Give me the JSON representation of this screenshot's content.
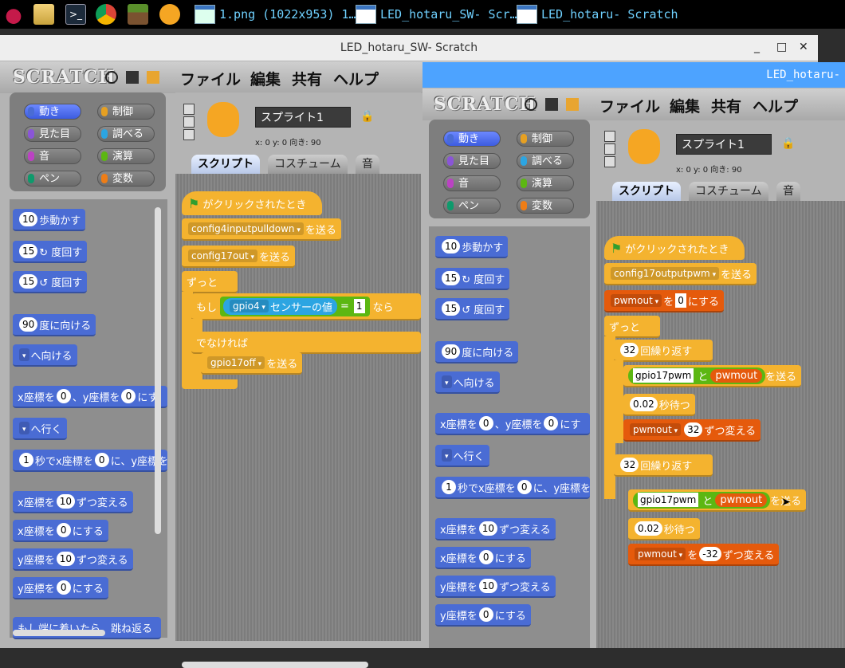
{
  "taskbar": {
    "tasks": [
      {
        "label": "1.png (1022x953) 1…"
      },
      {
        "label": "LED_hotaru_SW- Scr…"
      },
      {
        "label": "LED_hotaru- Scratch"
      }
    ]
  },
  "win1": {
    "title": "LED_hotaru_SW- Scratch",
    "logo": "SCRATCH",
    "menu": [
      "ファイル",
      "編集",
      "共有",
      "ヘルプ"
    ],
    "categories": [
      "動き",
      "制御",
      "見た目",
      "調べる",
      "音",
      "演算",
      "ペン",
      "変数"
    ],
    "sprite_name": "スプライト1",
    "coords": "x: 0   y: 0   向き: 90",
    "tabs": [
      "スクリプト",
      "コスチューム",
      "音"
    ],
    "palette": {
      "move": "歩動かす",
      "move_n": "10",
      "turn_r": "↻ 度回す",
      "turn_l": "↺ 度回す",
      "turn_n": "15",
      "point_dir": "度に向ける",
      "point_n": "90",
      "point_to": "へ向ける",
      "goto_xy_a": "x座標を",
      "goto_xy_b": "、y座標を",
      "goto_xy_c": "にす",
      "goto": "へ行く",
      "glide_a": "秒でx座標を",
      "glide_b": "に、y座標を",
      "change_x": "x座標を",
      "change_by": "ずつ変える",
      "set_x": "x座標を",
      "set_to": "にする",
      "change_y": "y座標を",
      "set_y": "y座標を",
      "bounce": "もし端に着いたら、跳ね返る",
      "zero": "0",
      "one": "1",
      "ten": "10"
    },
    "script": {
      "hat": "がクリックされたとき",
      "b1": "config4inputpulldown",
      "send": "を送る",
      "b2": "config17out",
      "forever": "ずっと",
      "if": "もし",
      "sensor": "gpio4",
      "sensor_label": "センサーの値",
      "eq": "=",
      "eq_val": "1",
      "then": "なら",
      "else": "でなければ",
      "b3": "gpio17off"
    }
  },
  "win2": {
    "title": "LED_hotaru-",
    "logo": "SCRATCH",
    "menu": [
      "ファイル",
      "編集",
      "共有",
      "ヘルプ"
    ],
    "categories": [
      "動き",
      "制御",
      "見た目",
      "調べる",
      "音",
      "演算",
      "ペン",
      "変数"
    ],
    "sprite_name": "スプライト1",
    "coords": "x: 0   y: 0   向き: 90",
    "tabs": [
      "スクリプト",
      "コスチューム",
      "音"
    ],
    "script": {
      "hat": "がクリックされたとき",
      "b1": "config17outputpwm",
      "send": "を送る",
      "var": "pwmout",
      "set": "を",
      "set_val": "0",
      "set_end": "にする",
      "forever": "ずっと",
      "repeat_n": "32",
      "repeat": "回繰り返す",
      "join_a": "gpio17pwm",
      "join": "と",
      "join_b": "pwmout",
      "wait_n": "0.02",
      "wait": "秒待つ",
      "change_n": "32",
      "change_neg": "-32",
      "change": "ずつ変える"
    }
  }
}
